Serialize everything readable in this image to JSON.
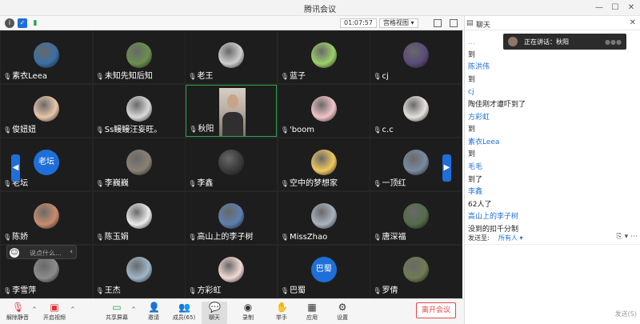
{
  "window": {
    "title": "腾讯会议"
  },
  "topbar": {
    "timer": "01:07:57",
    "view_mode": "宫格视图 ▾"
  },
  "tiles": [
    {
      "name": "素衣Leea",
      "type": "avatar",
      "color": "#3b6ea5"
    },
    {
      "name": "未知先知后知",
      "type": "avatar",
      "color": "#6a8f4e"
    },
    {
      "name": "老王",
      "type": "avatar",
      "color": "#cfcfcf"
    },
    {
      "name": "蓝子",
      "type": "avatar",
      "color": "#9bd06a"
    },
    {
      "name": "cj",
      "type": "avatar",
      "color": "#5a4b7a"
    },
    {
      "name": "俊妞妞",
      "type": "avatar",
      "color": "#e9c7a8"
    },
    {
      "name": "Ss鳗鳗汪妄旺。",
      "type": "avatar",
      "color": "#d9d9d9"
    },
    {
      "name": "秋阳",
      "type": "camera",
      "color": "#b9afa4"
    },
    {
      "name": "'boom",
      "type": "avatar",
      "color": "#f2c4c9"
    },
    {
      "name": "c.c",
      "type": "avatar",
      "color": "#e7e3de"
    },
    {
      "name": "老坛",
      "type": "text",
      "avatar_text": "老坛",
      "color": "#1e6fd9"
    },
    {
      "name": "李巍巍",
      "type": "avatar",
      "color": "#8a8174"
    },
    {
      "name": "李鑫",
      "type": "avatar",
      "color": "#3a3a3a"
    },
    {
      "name": "空中的梦想家",
      "type": "avatar",
      "color": "#f0c75e"
    },
    {
      "name": "一顶红",
      "type": "avatar",
      "color": "#7a8aa0"
    },
    {
      "name": "陈娇",
      "type": "avatar",
      "color": "#c98c6e"
    },
    {
      "name": "陈玉娟",
      "type": "avatar",
      "color": "#ececec"
    },
    {
      "name": "高山上的李子树",
      "type": "avatar",
      "color": "#5d7fae"
    },
    {
      "name": "MissZhao",
      "type": "avatar",
      "color": "#a9b3c0"
    },
    {
      "name": "唐深福",
      "type": "avatar",
      "color": "#556b4a"
    },
    {
      "name": "李雪萍",
      "type": "avatar",
      "color": "#8c8c8c"
    },
    {
      "name": "王杰",
      "type": "avatar",
      "color": "#9fb7c9"
    },
    {
      "name": "方彩虹",
      "type": "avatar",
      "color": "#f3d9d3"
    },
    {
      "name": "巴蜀",
      "type": "text",
      "avatar_text": "巴蜀",
      "color": "#1e6fd9"
    },
    {
      "name": "罗倩",
      "type": "avatar",
      "color": "#6f7c52"
    }
  ],
  "say_box": {
    "placeholder": "说点什么..."
  },
  "toolbar": {
    "mute": "解除静音",
    "video": "开启视频",
    "share": "共享屏幕",
    "invite": "邀请",
    "members": "成员(65)",
    "chat": "聊天",
    "record": "录制",
    "raise_hand": "举手",
    "apps": "应用",
    "settings": "设置",
    "leave": "离开会议"
  },
  "chat": {
    "title": "聊天",
    "speaking": "正在讲话：秋阳",
    "messages": [
      {
        "kind": "hidden-top",
        "text": "…"
      },
      {
        "kind": "text",
        "text": "到"
      },
      {
        "kind": "user",
        "text": "陈洪伟"
      },
      {
        "kind": "text",
        "text": "到"
      },
      {
        "kind": "user",
        "text": "cj"
      },
      {
        "kind": "text",
        "text": "陶佳刚才遭吓到了"
      },
      {
        "kind": "user",
        "text": "方彩虹"
      },
      {
        "kind": "text",
        "text": "到"
      },
      {
        "kind": "user",
        "text": "素衣Leea"
      },
      {
        "kind": "text",
        "text": "到"
      },
      {
        "kind": "user",
        "text": "毛毛"
      },
      {
        "kind": "text",
        "text": "到了"
      },
      {
        "kind": "user",
        "text": "李鑫"
      },
      {
        "kind": "text",
        "text": "62人了"
      },
      {
        "kind": "user",
        "text": "高山上的李子树"
      },
      {
        "kind": "text",
        "text": "没到的扣千分制"
      }
    ],
    "send_to_label": "发送至:",
    "send_to_target": "所有人 ▾",
    "send_button": "发送(S)"
  }
}
